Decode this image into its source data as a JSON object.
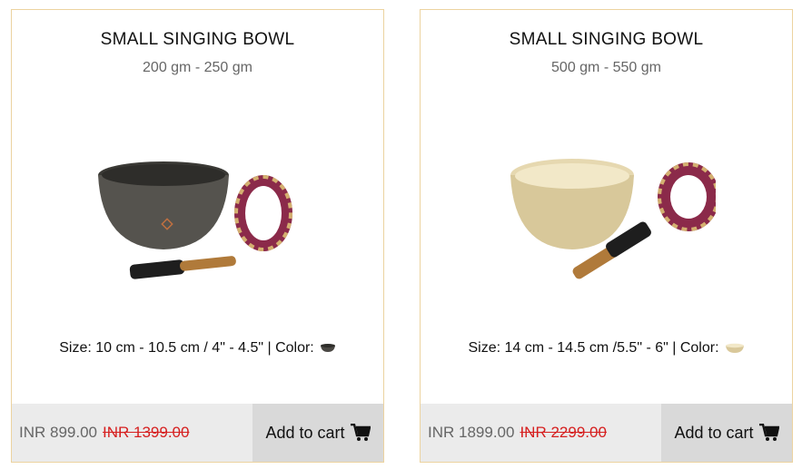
{
  "products": [
    {
      "title": "SMALL SINGING BOWL",
      "weight": "200 gm - 250 gm",
      "size_text": "Size: 10 cm - 10.5 cm / 4\" - 4.5\" | Color:",
      "price": "INR 899.00",
      "old_price": "INR 1399.00",
      "cart_label": "Add to cart",
      "bowl_color": "#4a4844"
    },
    {
      "title": "SMALL SINGING BOWL",
      "weight": "500 gm - 550 gm",
      "size_text": "Size: 14 cm - 14.5 cm /5.5\" - 6\" | Color:",
      "price": "INR 1899.00",
      "old_price": "INR 2299.00",
      "cart_label": "Add to cart",
      "bowl_color": "#d9c89a"
    }
  ],
  "icons": {
    "cart": "shopping-cart-icon"
  },
  "colors": {
    "card_border": "#ecd3a0",
    "old_price": "#d62020"
  }
}
